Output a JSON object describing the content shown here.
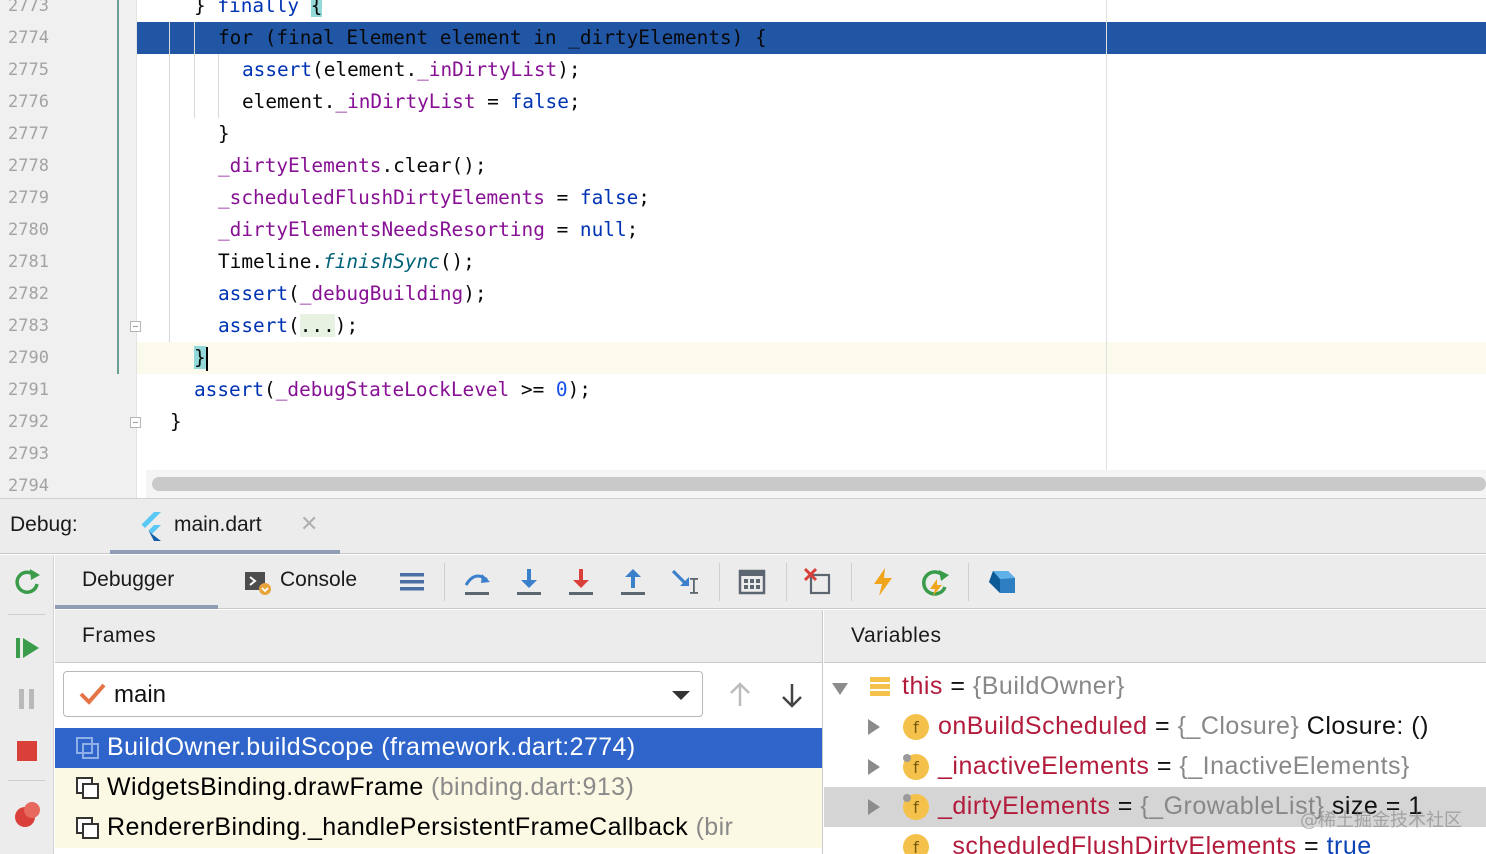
{
  "editor": {
    "lines": [
      {
        "n": "2773"
      },
      {
        "n": "2774"
      },
      {
        "n": "2775"
      },
      {
        "n": "2776"
      },
      {
        "n": "2777"
      },
      {
        "n": "2778"
      },
      {
        "n": "2779"
      },
      {
        "n": "2780"
      },
      {
        "n": "2781"
      },
      {
        "n": "2782"
      },
      {
        "n": "2783"
      },
      {
        "n": "2790"
      },
      {
        "n": "2791"
      },
      {
        "n": "2792"
      },
      {
        "n": "2793"
      },
      {
        "n": "2794"
      }
    ],
    "code": {
      "l2773_a": "} ",
      "l2773_kw": "finally",
      "l2773_b": " ",
      "l2773_brace": "{",
      "l2774": "for (final Element element in _dirtyElements) {",
      "l2775_a": "assert",
      "l2775_b": "(element.",
      "l2775_c": "_inDirtyList",
      "l2775_d": ");",
      "l2776_a": "element.",
      "l2776_b": "_inDirtyList",
      "l2776_c": " = ",
      "l2776_d": "false",
      "l2776_e": ";",
      "l2777": "}",
      "l2778_a": "_dirtyElements",
      "l2778_b": ".clear();",
      "l2779_a": "_scheduledFlushDirtyElements",
      "l2779_b": " = ",
      "l2779_c": "false",
      "l2779_d": ";",
      "l2780_a": "_dirtyElementsNeedsResorting",
      "l2780_b": " = ",
      "l2780_c": "null",
      "l2780_d": ";",
      "l2781_a": "Timeline.",
      "l2781_b": "finishSync",
      "l2781_c": "();",
      "l2782_a": "assert",
      "l2782_b": "(",
      "l2782_c": "_debugBuilding",
      "l2782_d": ");",
      "l2783_a": "assert",
      "l2783_b": "(",
      "l2783_c": "...",
      "l2783_d": ");",
      "l2790": "}",
      "l2791_a": "assert",
      "l2791_b": "(",
      "l2791_c": "_debugStateLockLevel",
      "l2791_d": " >= ",
      "l2791_e": "0",
      "l2791_f": ");",
      "l2792": "}"
    }
  },
  "debug": {
    "label": "Debug:",
    "run_tab": "main.dart",
    "close_glyph": "✕"
  },
  "toolbar": {
    "debugger_tab": "Debugger",
    "console_tab": "Console",
    "icons": [
      "frames-layout-icon",
      "step-over-icon",
      "step-into-icon",
      "force-step-into-icon",
      "step-out-icon",
      "run-to-cursor-icon",
      "evaluate-expression-icon",
      "remove-breakpoints-icon",
      "hot-reload-icon",
      "hot-restart-icon",
      "dart-devtools-icon"
    ]
  },
  "frames": {
    "title": "Frames",
    "thread": "main",
    "rows": [
      {
        "fn": "BuildOwner.buildScope",
        "loc": " (framework.dart:2774)"
      },
      {
        "fn": "WidgetsBinding.drawFrame",
        "loc": " (binding.dart:913)"
      },
      {
        "fn": "RendererBinding._handlePersistentFrameCallback",
        "loc": " (bir"
      }
    ]
  },
  "variables": {
    "title": "Variables",
    "rows": [
      {
        "name": "this",
        "eq": " = ",
        "type": "{BuildOwner}",
        "val": ""
      },
      {
        "name": "onBuildScheduled",
        "eq": " = ",
        "type": "{_Closure}",
        "val": " Closure: ()"
      },
      {
        "name": "_inactiveElements",
        "eq": " = ",
        "type": "{_InactiveElements}",
        "val": ""
      },
      {
        "name": "_dirtyElements",
        "eq": " = ",
        "type": "{_GrowableList}",
        "val": " size = 1"
      },
      {
        "name": "_scheduledFlushDirtyElements",
        "eq": " = ",
        "type": "",
        "val": "true"
      }
    ]
  },
  "watermark": "@稀土掘金技术社区",
  "colors": {
    "exec_line": "#2156a5",
    "selected_frame": "#2f65ca",
    "keyword": "#0033b3",
    "field": "#871094",
    "var_name": "#b31b3c"
  }
}
